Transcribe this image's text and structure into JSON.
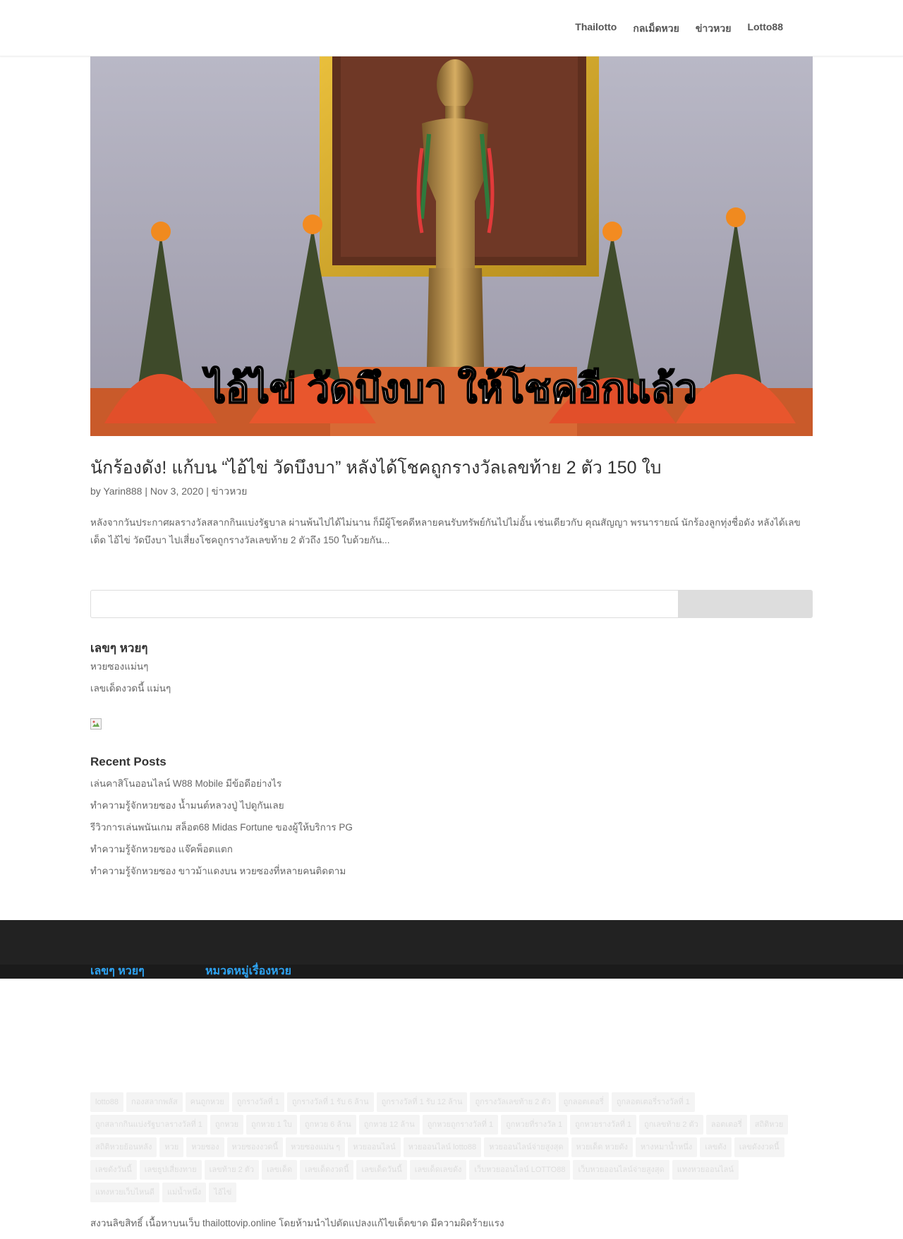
{
  "nav": {
    "items": [
      "Thailotto",
      "กลเม็ดหวย",
      "ข่าวหวย",
      "Lotto88"
    ]
  },
  "hero": {
    "overlay_text": "ไอ้ไข่ วัดบึงบา ให้โชคอีกแล้ว"
  },
  "post": {
    "title": "นักร้องดัง! แก้บน “ไอ้ไข่ วัดบึงบา” หลังได้โชคถูกรางวัลเลขท้าย 2 ตัว 150 ใบ",
    "meta_by": "by",
    "author": "Yarin888",
    "date": "Nov 3, 2020",
    "category": "ข่าวหวย",
    "separator": "|",
    "excerpt": "หลังจากวันประกาศผลรางวัลสลากกินแบ่งรัฐบาล ผ่านพ้นไปได้ไม่นาน ก็มีผู้โชคดีหลายคนรับทรัพย์กันไปไม่อั้น เช่นเดียวกับ คุณสัญญา พรนารายณ์ นักร้องลูกทุ่งชื่อดัง หลังได้เลขเด็ด ไอ้ไข่ วัดบึงบา ไปเสี่ยงโชคถูกรางวัลเลขท้าย 2 ตัวถึง 150 ใบด้วยกัน..."
  },
  "search": {
    "value": "",
    "placeholder": "",
    "button_label": ""
  },
  "widget_numbers": {
    "title": "เลขๆ หวยๆ",
    "links": [
      "หวยซองแม่นๆ",
      "เลขเด็ดงวดนี้ แม่นๆ"
    ]
  },
  "recent_posts": {
    "title": "Recent Posts",
    "links": [
      "เล่นคาสิโนออนไลน์ W88 Mobile มีข้อดีอย่างไร",
      "ทำความรู้จักหวยซอง น้ำมนต์หลวงปู่ ไปดูกันเลย",
      "รีวิวการเล่นพนันเกม สล็อต68 Midas Fortune ของผู้ให้บริการ PG",
      "ทำความรู้จักหวยซอง แจ๊คพ็อตแตก",
      "ทำความรู้จักหวยซอง ขาวม้าแดงบน หวยซองที่หลายคนติดตาม"
    ]
  },
  "footer": {
    "headings": [
      "เลขๆ หวยๆ",
      "หมวดหมู่เรื่องหวย"
    ],
    "tags": [
      "lotto88",
      "กองสลากพลัส",
      "คนถูกหวย",
      "ถูกรางวัลที่ 1",
      "ถูกรางวัลที่ 1 รับ 6 ล้าน",
      "ถูกรางวัลที่ 1 รับ 12 ล้าน",
      "ถูกรางวัลเลขท้าย 2 ตัว",
      "ถูกลอตเตอรี่",
      "ถูกลอตเตอรี่รางวัลที่ 1",
      "ถูกสลากกินแบ่งรัฐบาลรางวัลที่ 1",
      "ถูกหวย",
      "ถูกหวย 1 ใบ",
      "ถูกหวย 6 ล้าน",
      "ถูกหวย 12 ล้าน",
      "ถูกหวยถูกรางวัลที่ 1",
      "ถูกหวยที่รางวัล 1",
      "ถูกหวยรางวัลที่ 1",
      "ถูกเลขท้าย 2 ตัว",
      "ลอตเตอรี่",
      "สถิติหวย",
      "สถิติหวยย้อนหลัง",
      "หวย",
      "หวยซอง",
      "หวยซองงวดนี้",
      "หวยซองแม่น ๆ",
      "หวยออนไลน์",
      "หวยออนไลน์ lotto88",
      "หวยออนไลน์จ่ายสูงสุด",
      "หวยเด็ด หวยดัง",
      "หางหมาน้ำหนึ่ง",
      "เลขดัง",
      "เลขดังงวดนี้",
      "เลขดังวันนี้",
      "เลขธูปเสี่ยงทาย",
      "เลขท้าย 2 ตัว",
      "เลขเด็ด",
      "เลขเด็ดงวดนี้",
      "เลขเด็ดวันนี้",
      "เลขเด็ดเลขดัง",
      "เว็บหวยออนไลน์ LOTTO88",
      "เว็บหวยออนไลน์จ่ายสูงสุด",
      "แทงหวยออนไลน์",
      "แทงหวยเว็บไหนดี",
      "แม่น้ำหนึ่ง",
      "ไอ้ไข่"
    ],
    "copyright": "สงวนลิขสิทธิ์ เนื้อหาบนเว็บ thailottovip.online โดยห้ามนำไปตัดแปลงแก้ไขเด็ดขาด มีความผิดร้ายแรง"
  },
  "colors": {
    "footer_dark": "#222222",
    "link_blue": "#2ea3f2",
    "search_button": "#dddddd"
  }
}
